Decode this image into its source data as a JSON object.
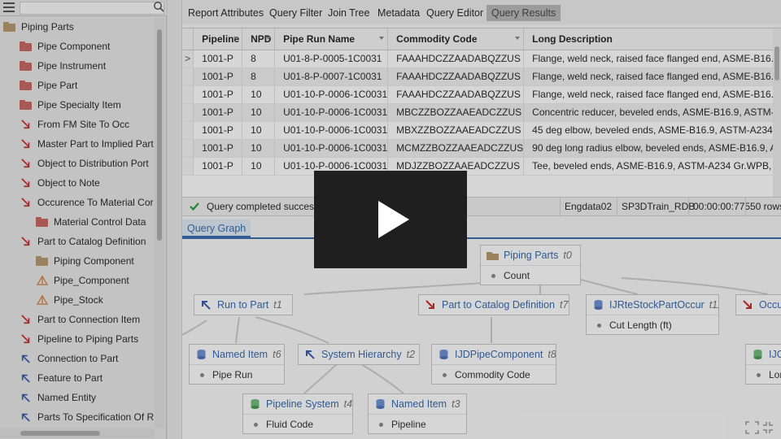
{
  "sidebar": {
    "tree": [
      {
        "label": "Piping Parts",
        "icon": "folder-icon",
        "color": "#b89a73"
      },
      {
        "label": "Pipe Component",
        "icon": "folder-icon",
        "color": "#c96b63"
      },
      {
        "label": "Pipe Instrument",
        "icon": "folder-icon",
        "color": "#c96b63"
      },
      {
        "label": "Pipe Part",
        "icon": "folder-icon",
        "color": "#c96b63"
      },
      {
        "label": "Pipe Specialty Item",
        "icon": "folder-icon",
        "color": "#c96b63"
      },
      {
        "label": "From FM Site To Occ",
        "icon": "relation-arrow-down-icon",
        "color": "#c9302c"
      },
      {
        "label": "Master Part to Implied Part",
        "icon": "relation-arrow-down-icon",
        "color": "#c9302c"
      },
      {
        "label": "Object to Distribution Port",
        "icon": "relation-arrow-down-icon",
        "color": "#c9302c"
      },
      {
        "label": "Object to Note",
        "icon": "relation-arrow-down-icon",
        "color": "#c9302c"
      },
      {
        "label": "Occurence To Material Cor",
        "icon": "relation-arrow-down-icon",
        "color": "#c9302c"
      },
      {
        "label": "Material Control Data",
        "icon": "folder-icon",
        "color": "#c96b63"
      },
      {
        "label": "Part to Catalog Definition",
        "icon": "relation-arrow-down-icon",
        "color": "#c9302c"
      },
      {
        "label": "Piping Component",
        "icon": "folder-icon",
        "color": "#b89a73"
      },
      {
        "label": "Pipe_Component",
        "icon": "pyramid-icon",
        "color": "#d9804a"
      },
      {
        "label": "Pipe_Stock",
        "icon": "pyramid-icon",
        "color": "#d9804a"
      },
      {
        "label": "Part to Connection Item",
        "icon": "relation-arrow-down-icon",
        "color": "#c9302c"
      },
      {
        "label": "Pipeline to Piping Parts",
        "icon": "relation-arrow-down-icon",
        "color": "#c9302c"
      },
      {
        "label": "Connection to Part",
        "icon": "relation-arrow-up-icon",
        "color": "#3a5fb0"
      },
      {
        "label": "Feature to Part",
        "icon": "relation-arrow-up-icon",
        "color": "#3a5fb0"
      },
      {
        "label": "Named Entity",
        "icon": "relation-arrow-up-icon",
        "color": "#3a5fb0"
      },
      {
        "label": "Parts To Specification Of R",
        "icon": "relation-arrow-up-icon",
        "color": "#3a5fb0"
      }
    ]
  },
  "tabs": [
    {
      "label": "Report Attributes",
      "active": false
    },
    {
      "label": "Query Filter",
      "active": false
    },
    {
      "label": "Join Tree",
      "active": false
    },
    {
      "label": "Metadata",
      "active": false
    },
    {
      "label": "Query Editor",
      "active": false
    },
    {
      "label": "Query Results",
      "active": true
    }
  ],
  "grid": {
    "columns": [
      "Pipeline",
      "NPD",
      "Pipe Run Name",
      "Commodity Code",
      "Long Description"
    ],
    "rows": [
      [
        "1001-P",
        "8",
        "U01-8-P-0005-1C0031",
        "FAAAHDCZZAADABQZZUS",
        "Flange, weld neck, raised face flanged end, ASME-B16."
      ],
      [
        "1001-P",
        "8",
        "U01-8-P-0007-1C0031",
        "FAAAHDCZZAADABQZZUS",
        "Flange, weld neck, raised face flanged end, ASME-B16."
      ],
      [
        "1001-P",
        "10",
        "U01-10-P-0006-1C0031",
        "FAAAHDCZZAADABQZZUS",
        "Flange, weld neck, raised face flanged end, ASME-B16."
      ],
      [
        "1001-P",
        "10",
        "U01-10-P-0006-1C0031",
        "MBCZZBOZZAAEADCZZUS",
        "Concentric reducer, beveled ends, ASME-B16.9, ASTM-"
      ],
      [
        "1001-P",
        "10",
        "U01-10-P-0006-1C0031",
        "MBXZZBOZZAAEADCZZUS",
        "45 deg elbow, beveled ends, ASME-B16.9, ASTM-A234"
      ],
      [
        "1001-P",
        "10",
        "U01-10-P-0006-1C0031",
        "MCMZZBOZZAAEADCZZUS",
        "90 deg long radius elbow, beveled ends, ASME-B16.9, A"
      ],
      [
        "1001-P",
        "10",
        "U01-10-P-0006-1C0031",
        "MDJZZBOZZAAEADCZZUS",
        "Tee, beveled ends, ASME-B16.9, ASTM-A234 Gr.WPB, F"
      ]
    ],
    "current_row_marker": ">"
  },
  "status": {
    "message": "Query completed success",
    "database": "Engdata02",
    "catalog": "SP3DTrain_RDB",
    "duration": "00:00:00:775",
    "rows": "50 rows"
  },
  "query_graph": {
    "tab_label": "Query Graph",
    "nodes": [
      {
        "id": "piping-parts",
        "title": "Piping Parts",
        "alias": "t0",
        "field": "Count",
        "icon": "folder-icon"
      },
      {
        "id": "run-to-part",
        "title": "Run to Part",
        "alias": "t1",
        "field": "",
        "icon": "relation-arrow-up-icon"
      },
      {
        "id": "part-to-catalog",
        "title": "Part to Catalog Definition",
        "alias": "t7",
        "field": "",
        "icon": "relation-arrow-down-icon"
      },
      {
        "id": "ijrte",
        "title": "IJRteStockPartOccur",
        "alias": "t11",
        "field": "Cut Length (ft)",
        "icon": "database-icon"
      },
      {
        "id": "occu",
        "title": "Occu",
        "alias": "",
        "field": "",
        "icon": "relation-arrow-down-icon"
      },
      {
        "id": "named-item",
        "title": "Named Item",
        "alias": "t6",
        "field": "Pipe Run",
        "icon": "database-icon"
      },
      {
        "id": "system-hierarchy",
        "title": "System Hierarchy",
        "alias": "t2",
        "field": "",
        "icon": "relation-arrow-up-icon"
      },
      {
        "id": "ijdpipe",
        "title": "IJDPipeComponent",
        "alias": "t8",
        "field": "Commodity Code",
        "icon": "database-icon"
      },
      {
        "id": "ijg",
        "title": "IJG",
        "alias": "",
        "field": "Lor",
        "icon": "database-green-icon"
      },
      {
        "id": "pipeline-system",
        "title": "Pipeline System",
        "alias": "t4",
        "field": "Fluid Code",
        "icon": "database-green-icon"
      },
      {
        "id": "named-item-3",
        "title": "Named Item",
        "alias": "t3",
        "field": "Pipeline",
        "icon": "database-icon"
      }
    ]
  },
  "colors": {
    "accent": "#3b6fb0",
    "relation_down": "#c9302c",
    "relation_up": "#3a5fb0",
    "folder_red": "#c96b63",
    "folder_tan": "#b89a73",
    "success": "#2e9b3d"
  },
  "overlay": {
    "icon": "play-icon"
  }
}
